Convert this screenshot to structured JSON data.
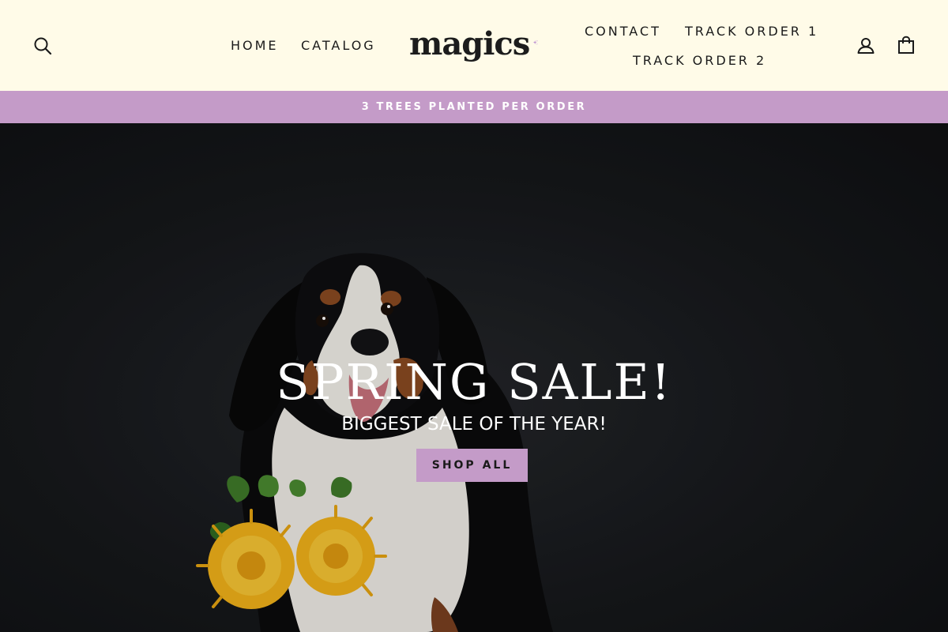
{
  "header": {
    "nav_left": [
      {
        "label": "HOME"
      },
      {
        "label": "CATALOG"
      }
    ],
    "nav_right": [
      {
        "label": "CONTACT"
      },
      {
        "label": "TRACK ORDER 1"
      },
      {
        "label": "TRACK ORDER 2"
      }
    ],
    "logo": {
      "text": "magics",
      "sparkle_color": "#b98ccf"
    },
    "icons": [
      "search-icon",
      "account-icon",
      "cart-icon"
    ]
  },
  "announcement": {
    "text": "3 TREES PLANTED PER ORDER",
    "background": "#c49bc8"
  },
  "hero": {
    "title": "SPRING SALE!",
    "subtitle": "BIGGEST SALE OF THE YEAR!",
    "cta_label": "SHOP ALL",
    "cta_color": "#c49bc8",
    "image_subject": "dog-with-yellow-flowers"
  },
  "colors": {
    "header_bg": "#fffbe8",
    "accent": "#c49bc8",
    "hero_bg": "#16181b"
  }
}
